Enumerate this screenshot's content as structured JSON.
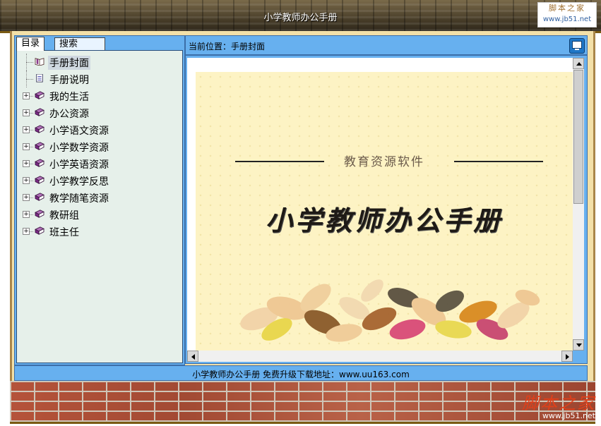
{
  "window": {
    "title": "小学教师办公手册"
  },
  "watermark": {
    "top_line1": "脚本之家",
    "top_line2": "www.jb51.net",
    "bottom_line1": "脚本之家",
    "bottom_line2": "www.jb51.net"
  },
  "sidebar": {
    "tabs": [
      {
        "label": "目录"
      },
      {
        "label": "搜索"
      }
    ],
    "items": [
      {
        "label": "手册封面",
        "expandable": false,
        "selected": true,
        "icon": "open-book-icon"
      },
      {
        "label": "手册说明",
        "expandable": false,
        "selected": false,
        "icon": "document-icon"
      },
      {
        "label": "我的生活",
        "expandable": true,
        "icon": "book-icon"
      },
      {
        "label": "办公资源",
        "expandable": true,
        "icon": "book-icon"
      },
      {
        "label": "小学语文资源",
        "expandable": true,
        "icon": "book-icon"
      },
      {
        "label": "小学数学资源",
        "expandable": true,
        "icon": "book-icon"
      },
      {
        "label": "小学英语资源",
        "expandable": true,
        "icon": "book-icon"
      },
      {
        "label": "小学教学反思",
        "expandable": true,
        "icon": "book-icon"
      },
      {
        "label": "教学随笔资源",
        "expandable": true,
        "icon": "book-icon"
      },
      {
        "label": "教研组",
        "expandable": true,
        "icon": "book-icon"
      },
      {
        "label": "班主任",
        "expandable": true,
        "icon": "book-icon"
      }
    ]
  },
  "location": {
    "label": "当前位置：",
    "value": "手册封面"
  },
  "cover": {
    "subtitle": "教育资源软件",
    "title": "小学教师办公手册"
  },
  "statusbar": {
    "text": "小学教师办公手册 免费升级下载地址：www.uu163.com"
  },
  "colors": {
    "panel": "#67b0ef",
    "tree_bg": "#e6f0ea",
    "cover_bg": "#fdf3c4"
  }
}
